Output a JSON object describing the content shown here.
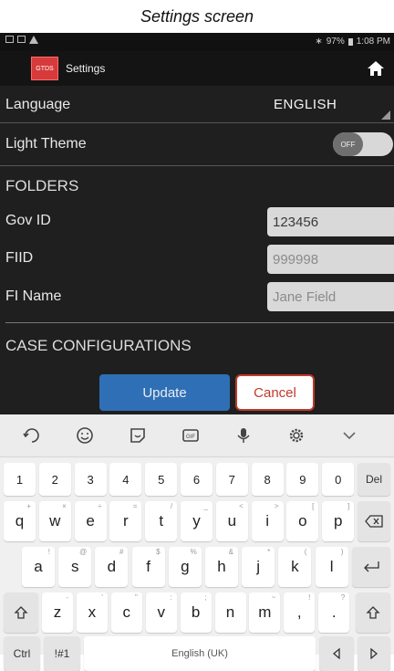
{
  "caption": "Settings screen",
  "status_bar": {
    "battery": "97%",
    "time": "1:08 PM"
  },
  "app_bar": {
    "logo_text": "GTDS",
    "title": "Settings"
  },
  "settings": {
    "language_label": "Language",
    "language_value": "ENGLISH",
    "light_theme_label": "Light Theme",
    "light_theme_state": "OFF",
    "folders_header": "FOLDERS",
    "gov_id_label": "Gov ID",
    "gov_id_value": "123456",
    "fiid_label": "FIID",
    "fiid_value": "999998",
    "fi_name_label": "FI Name",
    "fi_name_value": "Jane Field",
    "case_config_header": "CASE CONFIGURATIONS",
    "update_label": "Update",
    "cancel_label": "Cancel"
  },
  "keyboard": {
    "number_row": [
      "1",
      "2",
      "3",
      "4",
      "5",
      "6",
      "7",
      "8",
      "9",
      "0"
    ],
    "del_label": "Del",
    "row1": [
      "q",
      "w",
      "e",
      "r",
      "t",
      "y",
      "u",
      "i",
      "o",
      "p"
    ],
    "row1_hints": [
      "+",
      "×",
      "÷",
      "=",
      "/",
      "_",
      "<",
      ">",
      "[",
      "]"
    ],
    "row2": [
      "a",
      "s",
      "d",
      "f",
      "g",
      "h",
      "j",
      "k",
      "l"
    ],
    "row2_hints": [
      "!",
      "@",
      "#",
      "$",
      "%",
      "&",
      "*",
      "(",
      ")"
    ],
    "row3": [
      "z",
      "x",
      "c",
      "v",
      "b",
      "n",
      "m",
      ",",
      "."
    ],
    "row3_hints": [
      "-",
      "'",
      "\"",
      ":",
      ";",
      "",
      "~",
      "!",
      "?"
    ],
    "ctrl_label": "Ctrl",
    "sym_label": "!#1",
    "space_label": "English (UK)"
  },
  "colors": {
    "accent_blue": "#2f6fb5",
    "cancel_red": "#c0392b",
    "logo_red": "#d73a3a",
    "app_bg": "#1f1f1f"
  }
}
